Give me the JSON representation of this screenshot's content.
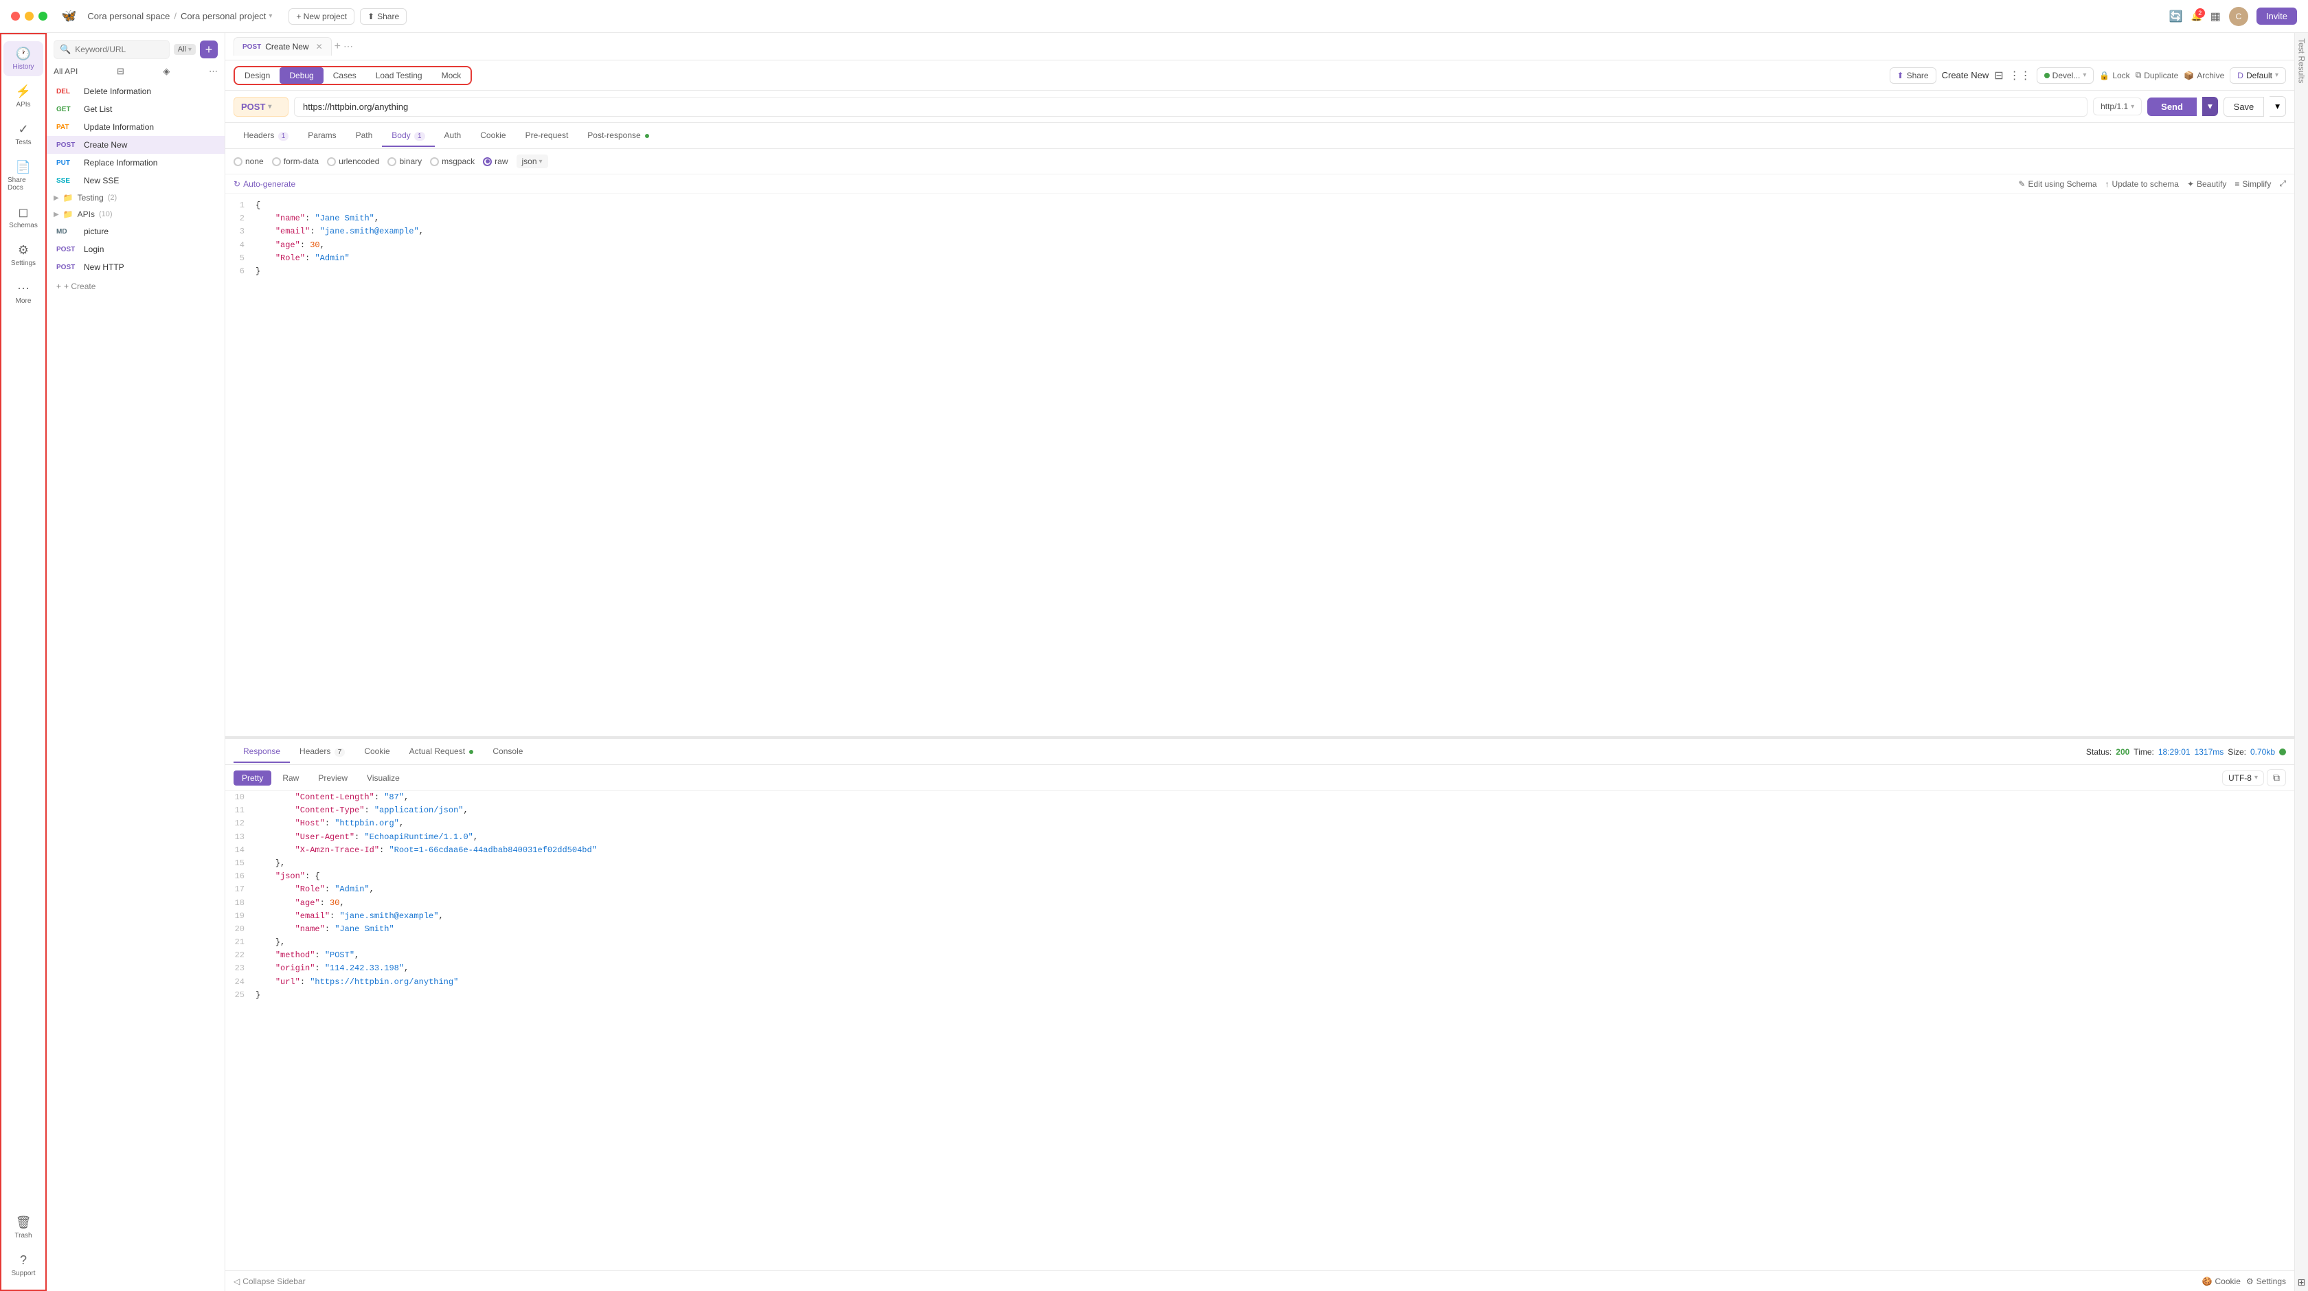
{
  "titlebar": {
    "personal_space": "Cora personal space",
    "separator": "/",
    "project_name": "Cora personal project",
    "new_project_label": "+ New project",
    "share_label": "Share",
    "invite_label": "Invite",
    "notif_count": "2"
  },
  "sidebar": {
    "items": [
      {
        "id": "history",
        "label": "History",
        "icon": "🕐"
      },
      {
        "id": "apis",
        "label": "APIs",
        "icon": "⚡"
      },
      {
        "id": "tests",
        "label": "Tests",
        "icon": "✓"
      },
      {
        "id": "share-docs",
        "label": "Share Docs",
        "icon": "📄"
      },
      {
        "id": "schemas",
        "label": "Schemas",
        "icon": "◻"
      },
      {
        "id": "settings",
        "label": "Settings",
        "icon": "⚙"
      },
      {
        "id": "more",
        "label": "More",
        "icon": "···"
      },
      {
        "id": "trash",
        "label": "Trash",
        "icon": "🗑"
      },
      {
        "id": "support",
        "label": "Support",
        "icon": "?"
      }
    ]
  },
  "file_panel": {
    "search_placeholder": "Keyword/URL",
    "all_label": "All",
    "all_apis_label": "All API",
    "api_items": [
      {
        "method": "DEL",
        "name": "Delete Information",
        "method_class": "method-del"
      },
      {
        "method": "GET",
        "name": "Get List",
        "method_class": "method-get"
      },
      {
        "method": "PAT",
        "name": "Update Information",
        "method_class": "method-pat"
      },
      {
        "method": "POST",
        "name": "Create New",
        "method_class": "method-post",
        "active": true
      },
      {
        "method": "PUT",
        "name": "Replace Information",
        "method_class": "method-put"
      },
      {
        "method": "SSE",
        "name": "New SSE",
        "method_class": "method-sse"
      }
    ],
    "folders": [
      {
        "name": "Testing",
        "count": 2
      },
      {
        "name": "APIs",
        "count": 10
      }
    ],
    "extra_items": [
      {
        "method": "MD",
        "name": "picture",
        "method_class": "method-md"
      },
      {
        "method": "POST",
        "name": "Login",
        "method_class": "method-post"
      },
      {
        "method": "POST",
        "name": "New HTTP",
        "method_class": "method-post"
      }
    ],
    "create_label": "+ Create"
  },
  "tabs": [
    {
      "method": "POST",
      "name": "Create New",
      "active": true
    }
  ],
  "toolbar_tabs": [
    {
      "label": "Design",
      "active": false
    },
    {
      "label": "Debug",
      "active": true
    },
    {
      "label": "Cases",
      "active": false
    },
    {
      "label": "Load Testing",
      "active": false
    },
    {
      "label": "Mock",
      "active": false
    }
  ],
  "toolbar": {
    "share_label": "Share",
    "create_new_label": "Create New",
    "env_label": "Devel...",
    "lock_label": "Lock",
    "duplicate_label": "Duplicate",
    "archive_label": "Archive",
    "default_label": "Default",
    "simplify_label": "Simplify"
  },
  "request": {
    "method": "POST",
    "url": "https://httpbin.org/anything",
    "http_version": "http/1.1",
    "send_label": "Send",
    "save_label": "Save"
  },
  "request_tabs": [
    {
      "label": "Headers",
      "count": 1,
      "active": false
    },
    {
      "label": "Params",
      "active": false
    },
    {
      "label": "Path",
      "active": false
    },
    {
      "label": "Body",
      "count": 1,
      "active": true
    },
    {
      "label": "Auth",
      "active": false
    },
    {
      "label": "Cookie",
      "active": false
    },
    {
      "label": "Pre-request",
      "active": false
    },
    {
      "label": "Post-response",
      "dot": true,
      "active": false
    }
  ],
  "body_options": [
    {
      "label": "none",
      "checked": false
    },
    {
      "label": "form-data",
      "checked": false
    },
    {
      "label": "urlencoded",
      "checked": false
    },
    {
      "label": "binary",
      "checked": false
    },
    {
      "label": "msgpack",
      "checked": false
    },
    {
      "label": "raw",
      "checked": true
    },
    {
      "label": "json",
      "checked": false
    }
  ],
  "code_editor": {
    "auto_generate_label": "Auto-generate",
    "edit_schema_label": "Edit using Schema",
    "update_schema_label": "Update to schema",
    "beautify_label": "Beautify",
    "simplify_label": "Simplify",
    "lines": [
      {
        "num": 1,
        "content": "{"
      },
      {
        "num": 2,
        "content": "    \"name\": \"Jane Smith\","
      },
      {
        "num": 3,
        "content": "    \"email\": \"jane.smith@example\","
      },
      {
        "num": 4,
        "content": "    \"age\": 30,"
      },
      {
        "num": 5,
        "content": "    \"Role\": \"Admin\""
      },
      {
        "num": 6,
        "content": "}"
      }
    ]
  },
  "response": {
    "tabs": [
      {
        "label": "Response",
        "active": true
      },
      {
        "label": "Headers",
        "count": 7,
        "active": false
      },
      {
        "label": "Cookie",
        "active": false
      },
      {
        "label": "Actual Request",
        "dot": true,
        "active": false
      },
      {
        "label": "Console",
        "active": false
      }
    ],
    "status_label": "Status:",
    "status_code": "200",
    "time_label": "Time:",
    "time_value": "18:29:01",
    "time_ms": "1317ms",
    "size_label": "Size:",
    "size_value": "0.70kb",
    "view_tabs": [
      {
        "label": "Pretty",
        "active": true
      },
      {
        "label": "Raw",
        "active": false
      },
      {
        "label": "Preview",
        "active": false
      },
      {
        "label": "Visualize",
        "active": false
      }
    ],
    "encoding": "UTF-8",
    "lines": [
      {
        "num": 10,
        "content": "        \"Content-Length\": \"87\","
      },
      {
        "num": 11,
        "content": "        \"Content-Type\": \"application/json\","
      },
      {
        "num": 12,
        "content": "        \"Host\": \"httpbin.org\","
      },
      {
        "num": 13,
        "content": "        \"User-Agent\": \"EchoapiRuntime/1.1.0\","
      },
      {
        "num": 14,
        "content": "        \"X-Amzn-Trace-Id\": \"Root=1-66cdaa6e-44adbab840031ef02dd504bd\""
      },
      {
        "num": 15,
        "content": "    },"
      },
      {
        "num": 16,
        "content": "    \"json\": {"
      },
      {
        "num": 17,
        "content": "        \"Role\": \"Admin\","
      },
      {
        "num": 18,
        "content": "        \"age\": 30,"
      },
      {
        "num": 19,
        "content": "        \"email\": \"jane.smith@example\","
      },
      {
        "num": 20,
        "content": "        \"name\": \"Jane Smith\""
      },
      {
        "num": 21,
        "content": "    },"
      },
      {
        "num": 22,
        "content": "    \"method\": \"POST\","
      },
      {
        "num": 23,
        "content": "    \"origin\": \"114.242.33.198\","
      },
      {
        "num": 24,
        "content": "    \"url\": \"https://httpbin.org/anything\""
      },
      {
        "num": 25,
        "content": "}"
      }
    ]
  },
  "bottom_bar": {
    "collapse_label": "Collapse Sidebar",
    "cookie_label": "Cookie",
    "settings_label": "Settings"
  }
}
